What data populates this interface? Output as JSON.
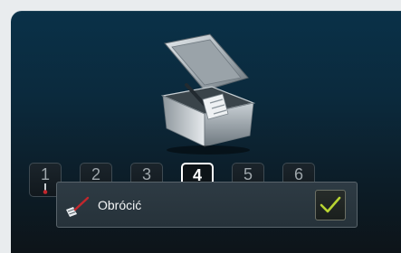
{
  "steps": [
    {
      "number": "1",
      "icon": "thermometer-icon",
      "active": false
    },
    {
      "number": "2",
      "icon": "step-icon",
      "active": false
    },
    {
      "number": "3",
      "icon": "step-icon",
      "active": false
    },
    {
      "number": "4",
      "icon": "step-icon",
      "active": true
    },
    {
      "number": "5",
      "icon": "step-icon",
      "active": false
    },
    {
      "number": "6",
      "icon": "step-icon",
      "active": false
    }
  ],
  "instruction": {
    "label": "Obrócić",
    "icon": "spatula-icon",
    "confirm_icon": "checkmark-icon"
  },
  "hero_image": "fryer-basket-with-spatula",
  "colors": {
    "background_top": "#0a3148",
    "background_bottom": "#0d1419",
    "active_step_border": "#ffffff",
    "confirm_check": "#b8d432",
    "tool_accent": "#c2272d"
  }
}
